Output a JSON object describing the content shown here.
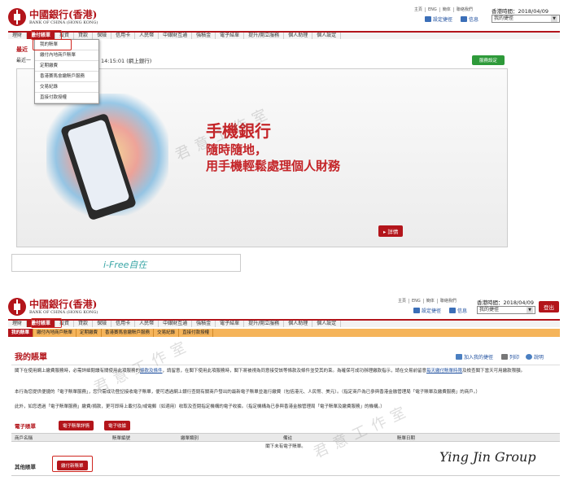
{
  "brand": {
    "name_cn": "中國銀行(香港)",
    "name_en": "BANK OF CHINA (HONG KONG)",
    "color": "#b3151b"
  },
  "top_links": [
    "主頁",
    "ENG",
    "簡体",
    "聯絡我們"
  ],
  "hk_time_label": "香港時間：2018/04/09",
  "shortcut_select": "我的捷徑",
  "settings_link": "設定捷徑",
  "mail_link": "信息",
  "nav": [
    "理財",
    "繳付賬單",
    "投資",
    "貸款",
    "保險",
    "信用卡",
    "人民幣",
    "中銀財互通",
    "強積金",
    "電子結單",
    "提升/開立服務",
    "個人助理",
    "個人設定"
  ],
  "dropdown_items": [
    "我的賬單",
    "繳付內地商戶賬單",
    "定期繳費",
    "香港賽馬會繳賬戶服務",
    "交易紀錄",
    "直接付款授權"
  ],
  "panel1": {
    "last_login_label": "最近一",
    "last_login_time": "14:15:01 (網上銀行)",
    "page_head": "最近",
    "green_button": "服務設定",
    "banner": {
      "title": "手機銀行",
      "subtitle1": "隨時隨地，",
      "subtitle2": "用手機輕鬆處理個人財務",
      "detail_button": "詳情"
    },
    "ifree": "i-Free自在"
  },
  "panel2": {
    "logout": "登出",
    "subnav": [
      "我的賬單",
      "繳付內地商戶賬單",
      "定期繳費",
      "香港賽馬會繳賬戶服務",
      "交易紀錄",
      "直接付款授權"
    ],
    "title": "我的賬單",
    "actions": [
      "加入我的捷徑",
      "列印",
      "說明"
    ],
    "para1a": "閣下在使用網上繳費服務時，必需詳細閱讀有關使用此項服務的",
    "para1_link": "條款及條件",
    "para1b": "，請留意，在閣下使用此項服務時，閣下將被視為同意接受該等條款及條件並受其約束。為確保可成功辦理繳款指示，請在交易前留意",
    "para1_link2": "每天繳付賬單時限",
    "para1c": "及檢查閣下當天可用繳款限額。",
    "para2": "本行為您提供便捷的「電子賬單服務」，您只需成功登記接收電子賬單，便可透過網上銀行查閱有關商戶發出的最新電子賬單並進行繳費（包括港元、人民幣、美元）。（指定商戶為已參與香港金融管理局「電子賬單及繳費服務」的商戶。）",
    "para3": "此外，如您透過「電子賬單服務」繳費/捐款，更可即時上載付及/或電郵（如適用）收取及查閱指定機構的電子收據。（指定機構為已參與香港金融管理局「電子賬單及繳費服務」的機構。）",
    "ebill_label": "電子賬單",
    "ebill_buttons": [
      "電子賬單詳情",
      "電子收據"
    ],
    "table_headers": [
      "商戶名稱",
      "賬單編號",
      "繳單類別",
      "備註",
      "賬單日期"
    ],
    "empty_text": "閣下未有電子賬單。",
    "other_bills": "其他賬單",
    "pay_new_bill": "繳付新賬單"
  },
  "watermark": "君意工作室",
  "signature": "Ying Jin Group"
}
